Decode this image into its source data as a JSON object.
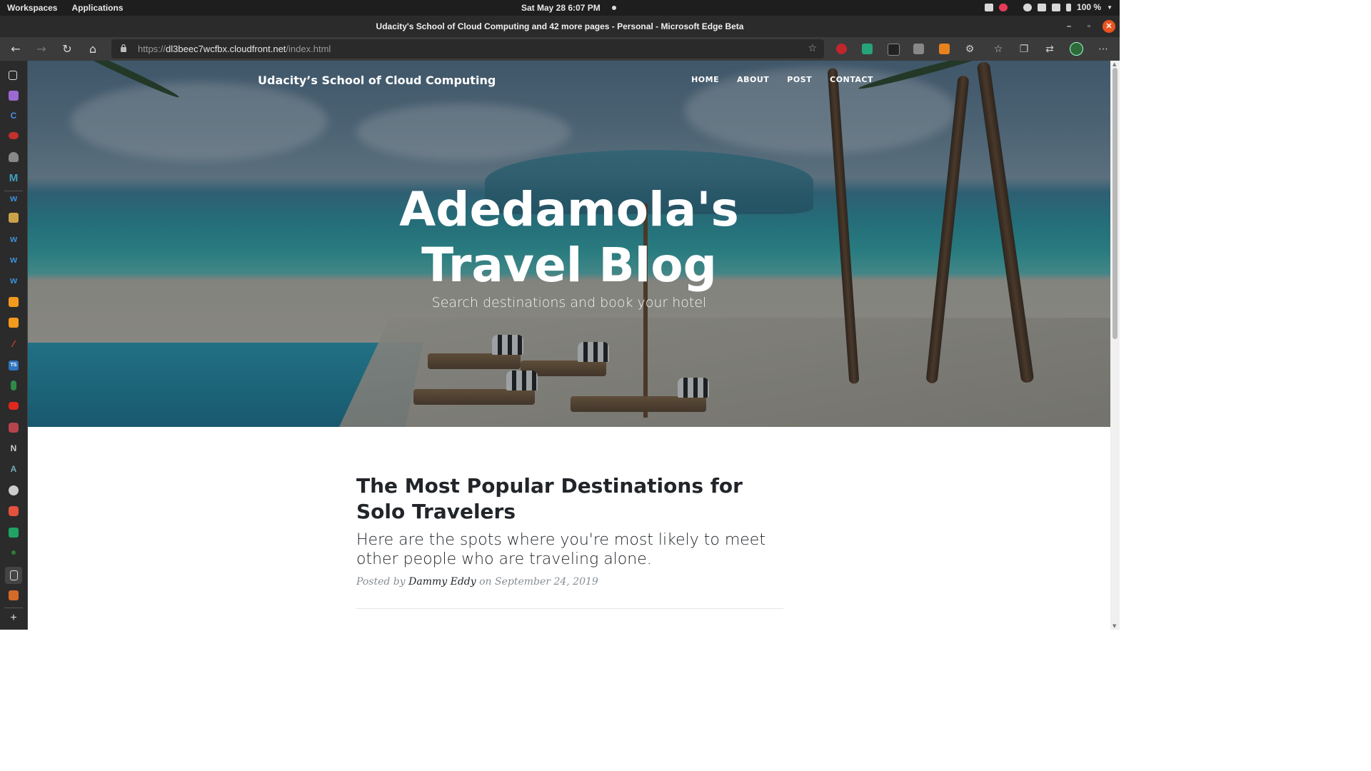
{
  "system_bar": {
    "workspaces": "Workspaces",
    "applications": "Applications",
    "datetime": "Sat May 28   6:07 PM",
    "battery": "100 %"
  },
  "browser": {
    "window_title": "Udacity's School of Cloud Computing and 42 more pages - Personal - Microsoft Edge Beta",
    "url_scheme": "https://",
    "url_host": "dl3beec7wcfbx.cloudfront.net",
    "url_path": "/index.html"
  },
  "sidebar": {
    "icons": [
      "tabs-icon",
      "tasks-icon",
      "c-app-icon",
      "youtube-icon",
      "shield-icon",
      "medium-icon",
      "webflow-icon",
      "box-icon",
      "webflow-icon",
      "webflow-icon",
      "webflow-icon",
      "aws-icon",
      "aws-icon",
      "jira-icon",
      "typescript-icon",
      "mongodb-icon",
      "youtube-icon",
      "search-app-icon",
      "notion-icon",
      "arch-icon",
      "chrome-icon",
      "todo-icon",
      "sheets-icon",
      "green-dot-icon",
      "page-icon",
      "java-icon",
      "add-icon"
    ],
    "labels": {
      "c": "C",
      "m": "M",
      "ts": "TS",
      "n": "N",
      "a": "A",
      "plus": "+"
    }
  },
  "site": {
    "brand": "Udacity’s School of Cloud Computing",
    "nav": {
      "home": "HOME",
      "about": "ABOUT",
      "post": "POST",
      "contact": "CONTACT"
    },
    "hero_title_line1": "Adedamola's",
    "hero_title_line2": "Travel Blog",
    "hero_subtitle": "Search destinations and book your hotel"
  },
  "post": {
    "title": "The Most Popular Destinations for Solo Travelers",
    "subtitle": "Here are the spots where you're most likely to meet other people who are traveling alone.",
    "posted_by": "Posted by",
    "author": "Dammy Eddy",
    "on": "on",
    "date": "September 24, 2019"
  },
  "colors": {
    "accent_close": "#e95420",
    "text_dark": "#212529",
    "meta_gray": "#868e96"
  }
}
